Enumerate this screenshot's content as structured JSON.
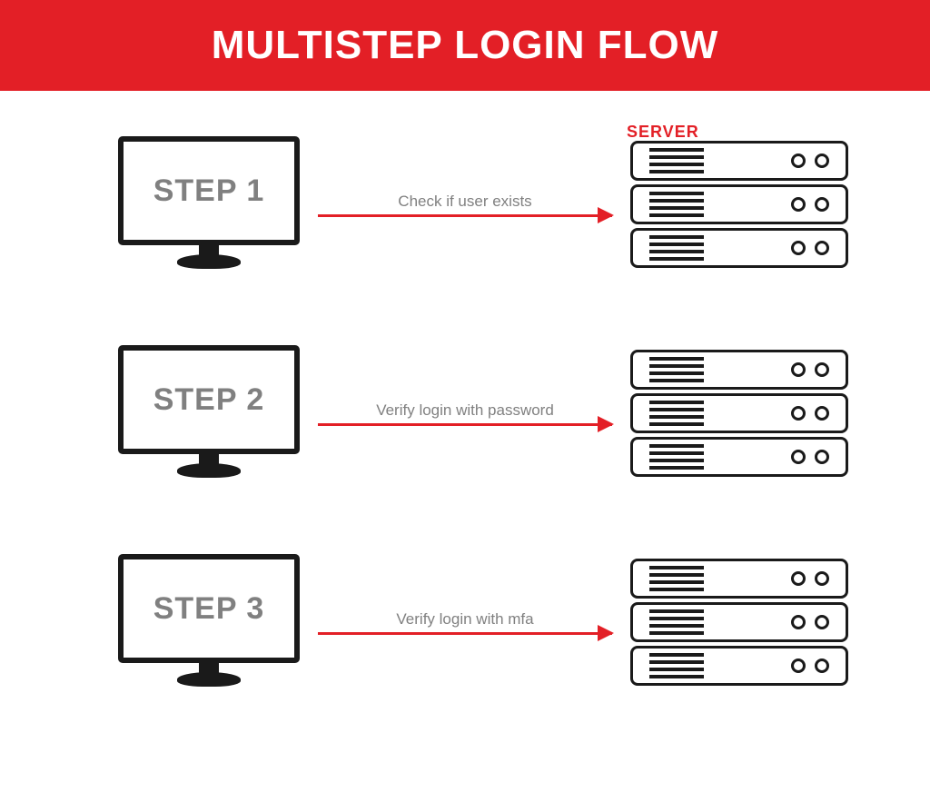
{
  "header": {
    "title": "MULTISTEP LOGIN FLOW"
  },
  "server_label": "SERVER",
  "steps": [
    {
      "label": "STEP 1",
      "description": "Check if user exists"
    },
    {
      "label": "STEP 2",
      "description": "Verify login with password"
    },
    {
      "label": "STEP 3",
      "description": "Verify login with mfa"
    }
  ],
  "colors": {
    "accent": "#e31f26",
    "text_muted": "#808080",
    "stroke": "#1a1a1a"
  }
}
